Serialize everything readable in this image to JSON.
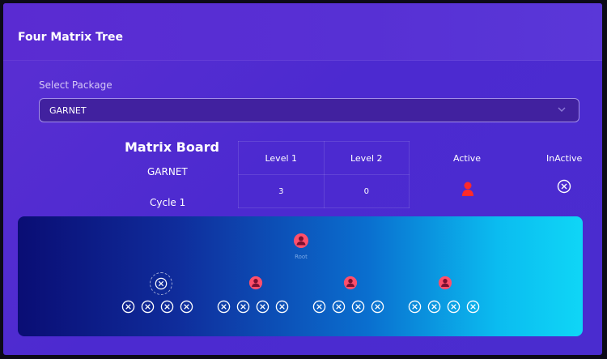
{
  "card": {
    "title": "Four Matrix Tree"
  },
  "package": {
    "label": "Select Package",
    "selected": "GARNET"
  },
  "matrix_board": {
    "title": "Matrix Board",
    "package_name": "GARNET",
    "cycle": "Cycle 1",
    "levels": [
      {
        "label": "Level 1",
        "value": "3"
      },
      {
        "label": "Level 2",
        "value": "0"
      }
    ]
  },
  "legend": {
    "active_label": "Active",
    "inactive_label": "InActive",
    "active_icon": "user-active-icon",
    "inactive_icon": "circle-x-icon"
  },
  "tree": {
    "root_label": "Root",
    "colors": {
      "active": "#ff4f6b",
      "inactive": "#ffffff"
    }
  }
}
